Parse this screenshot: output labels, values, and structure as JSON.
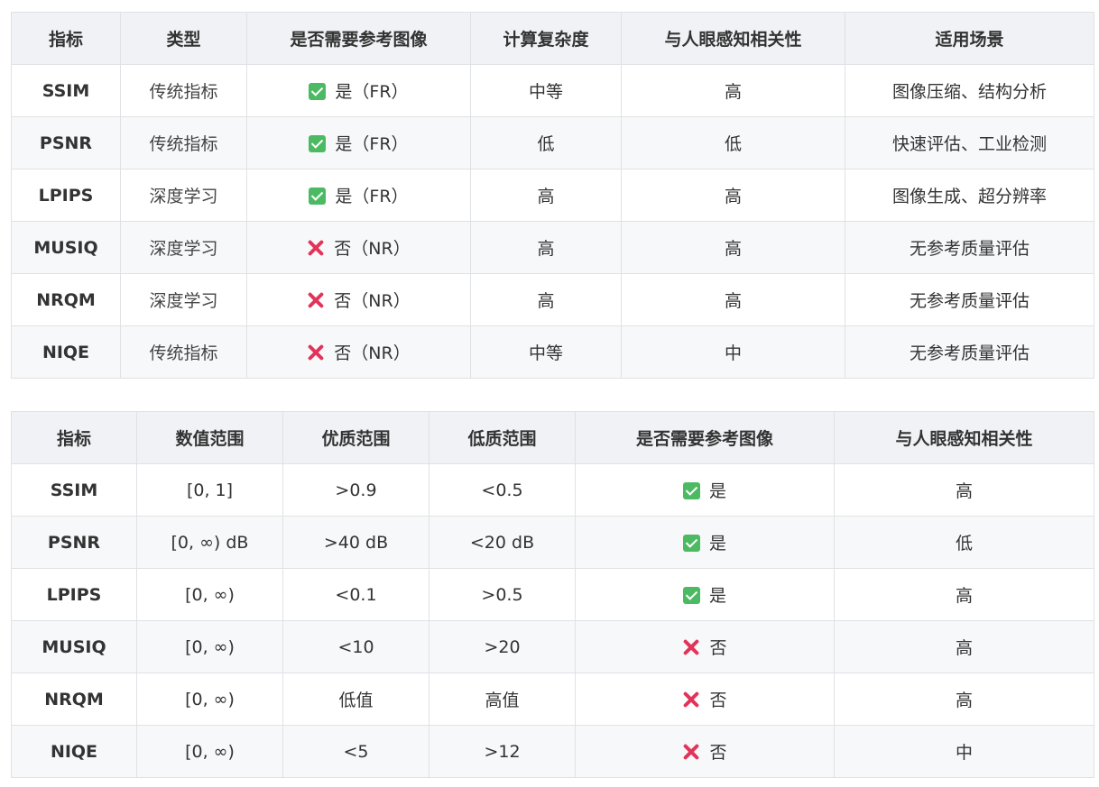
{
  "table1": {
    "headers": [
      "指标",
      "类型",
      "是否需要参考图像",
      "计算复杂度",
      "与人眼感知相关性",
      "适用场景"
    ],
    "rows": [
      {
        "metric": "SSIM",
        "type": "传统指标",
        "ref_icon": "check-icon",
        "ref": "是（FR）",
        "complexity": "中等",
        "correlation": "高",
        "scenario": "图像压缩、结构分析"
      },
      {
        "metric": "PSNR",
        "type": "传统指标",
        "ref_icon": "check-icon",
        "ref": "是（FR）",
        "complexity": "低",
        "correlation": "低",
        "scenario": "快速评估、工业检测"
      },
      {
        "metric": "LPIPS",
        "type": "深度学习",
        "ref_icon": "check-icon",
        "ref": "是（FR）",
        "complexity": "高",
        "correlation": "高",
        "scenario": "图像生成、超分辨率"
      },
      {
        "metric": "MUSIQ",
        "type": "深度学习",
        "ref_icon": "cross-icon",
        "ref": "否（NR）",
        "complexity": "高",
        "correlation": "高",
        "scenario": "无参考质量评估"
      },
      {
        "metric": "NRQM",
        "type": "深度学习",
        "ref_icon": "cross-icon",
        "ref": "否（NR）",
        "complexity": "高",
        "correlation": "高",
        "scenario": "无参考质量评估"
      },
      {
        "metric": "NIQE",
        "type": "传统指标",
        "ref_icon": "cross-icon",
        "ref": "否（NR）",
        "complexity": "中等",
        "correlation": "中",
        "scenario": "无参考质量评估"
      }
    ]
  },
  "table2": {
    "headers": [
      "指标",
      "数值范围",
      "优质范围",
      "低质范围",
      "是否需要参考图像",
      "与人眼感知相关性"
    ],
    "rows": [
      {
        "metric": "SSIM",
        "range": "[0, 1]",
        "good": ">0.9",
        "poor": "<0.5",
        "ref_icon": "check-icon",
        "ref": "是",
        "correlation": "高"
      },
      {
        "metric": "PSNR",
        "range": "[0, ∞) dB",
        "good": ">40 dB",
        "poor": "<20 dB",
        "ref_icon": "check-icon",
        "ref": "是",
        "correlation": "低"
      },
      {
        "metric": "LPIPS",
        "range": "[0, ∞)",
        "good": "<0.1",
        "poor": ">0.5",
        "ref_icon": "check-icon",
        "ref": "是",
        "correlation": "高"
      },
      {
        "metric": "MUSIQ",
        "range": "[0, ∞)",
        "good": "<10",
        "poor": ">20",
        "ref_icon": "cross-icon",
        "ref": "否",
        "correlation": "高"
      },
      {
        "metric": "NRQM",
        "range": "[0, ∞)",
        "good": "低值",
        "poor": "高值",
        "ref_icon": "cross-icon",
        "ref": "否",
        "correlation": "高"
      },
      {
        "metric": "NIQE",
        "range": "[0, ∞)",
        "good": "<5",
        "poor": ">12",
        "ref_icon": "cross-icon",
        "ref": "否",
        "correlation": "中"
      }
    ]
  },
  "colors": {
    "check": "#4cba63",
    "cross": "#e2345a",
    "header_bg": "#f0f2f5",
    "stripe_bg": "#f7f8fa",
    "border": "#dfe2e5"
  }
}
